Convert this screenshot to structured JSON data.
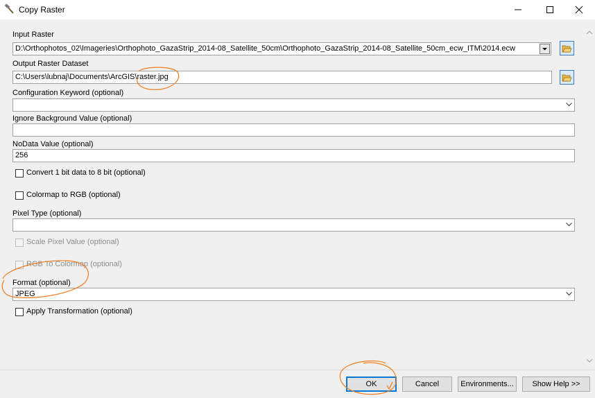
{
  "window": {
    "title": "Copy Raster",
    "icon": "hammer-icon",
    "controls": [
      "minimize-icon",
      "maximize-icon",
      "close-icon"
    ]
  },
  "form": {
    "input_raster": {
      "label": "Input Raster",
      "value": "D:\\Orthophotos_02\\Imageries\\Orthophoto_GazaStrip_2014-08_Satellite_50cm\\Orthophoto_GazaStrip_2014-08_Satellite_50cm_ecw_ITM\\2014.ecw"
    },
    "output_raster": {
      "label": "Output Raster Dataset",
      "value": "C:\\Users\\lubnaj\\Documents\\ArcGIS\\raster.jpg"
    },
    "config_keyword": {
      "label": "Configuration Keyword (optional)",
      "value": ""
    },
    "ignore_background": {
      "label": "Ignore Background Value (optional)",
      "value": ""
    },
    "nodata": {
      "label": "NoData Value (optional)",
      "value": "256"
    },
    "convert_1bit": {
      "label": "Convert 1 bit data to 8 bit (optional)",
      "checked": false
    },
    "colormap_rgb": {
      "label": "Colormap to RGB (optional)",
      "checked": false
    },
    "pixel_type": {
      "label": "Pixel Type (optional)",
      "value": ""
    },
    "scale_pixel": {
      "label": "Scale Pixel Value (optional)",
      "checked": false,
      "enabled": false
    },
    "rgb_colormap": {
      "label": "RGB To Colormap (optional)",
      "checked": false,
      "enabled": false
    },
    "format": {
      "label": "Format (optional)",
      "value": "JPEG"
    },
    "apply_transform": {
      "label": "Apply Transformation (optional)",
      "checked": false
    }
  },
  "buttons": {
    "ok": "OK",
    "cancel": "Cancel",
    "environments": "Environments...",
    "show_help": "Show Help >>"
  },
  "colors": {
    "annotation": "#f07c1e",
    "default_button_border": "#0078d7"
  }
}
